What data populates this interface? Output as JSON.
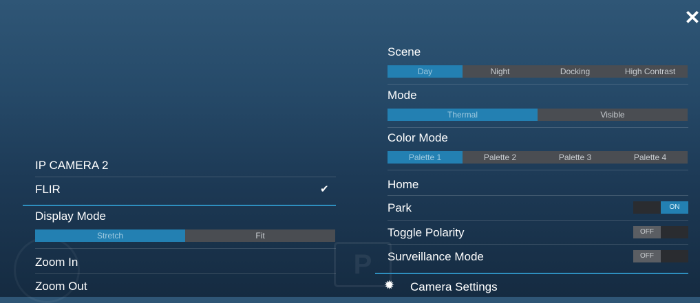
{
  "close_icon": "close-icon",
  "left": {
    "camera_name": "IP CAMERA 2",
    "camera_source": "FLIR",
    "display_mode_label": "Display Mode",
    "display_mode_options": [
      "Stretch",
      "Fit"
    ],
    "display_mode_selected": "Stretch",
    "zoom_in_label": "Zoom In",
    "zoom_out_label": "Zoom Out"
  },
  "right": {
    "scene_label": "Scene",
    "scene_options": [
      "Day",
      "Night",
      "Docking",
      "High Contrast"
    ],
    "scene_selected": "Day",
    "mode_label": "Mode",
    "mode_options": [
      "Thermal",
      "Visible"
    ],
    "mode_selected": "Thermal",
    "color_mode_label": "Color Mode",
    "color_mode_options": [
      "Palette 1",
      "Palette 2",
      "Palette 3",
      "Palette 4"
    ],
    "color_mode_selected": "Palette 1",
    "home_label": "Home",
    "park_label": "Park",
    "park_state": "ON",
    "toggle_polarity_label": "Toggle Polarity",
    "toggle_polarity_state": "OFF",
    "surveillance_label": "Surveillance Mode",
    "surveillance_state": "OFF",
    "camera_settings_label": "Camera Settings"
  },
  "colors": {
    "accent": "#2380b2",
    "background_top": "#2f5676",
    "background_bottom": "#152b41"
  }
}
